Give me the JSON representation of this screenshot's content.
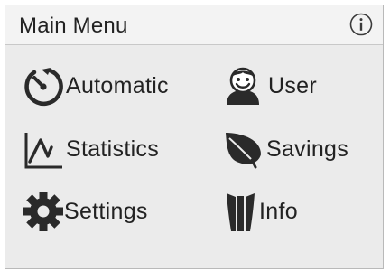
{
  "header": {
    "title": "Main Menu",
    "info_icon": "info-circle-icon"
  },
  "menu": {
    "items": [
      {
        "label": "Automatic",
        "icon": "timer-icon"
      },
      {
        "label": "User",
        "icon": "user-avatar-icon"
      },
      {
        "label": "Statistics",
        "icon": "line-chart-icon"
      },
      {
        "label": "Savings",
        "icon": "leaf-icon"
      },
      {
        "label": "Settings",
        "icon": "gear-icon"
      },
      {
        "label": "Info",
        "icon": "info-panel-icon"
      }
    ]
  },
  "colors": {
    "background": "#ebebeb",
    "header_background": "#f3f3f3",
    "icon": "#2a2a2a",
    "text": "#222222",
    "border": "#b9b9b9"
  }
}
